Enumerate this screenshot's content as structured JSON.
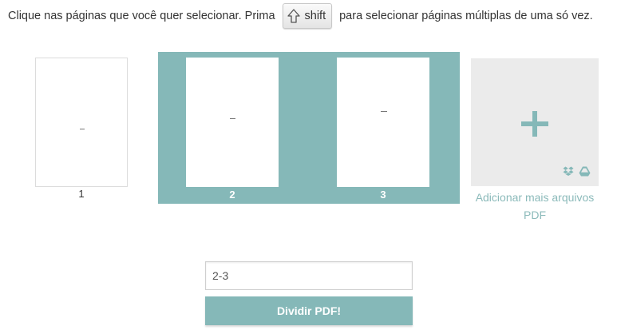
{
  "instruction": {
    "before": "Clique nas páginas que você quer selecionar. Prima",
    "key_label": "shift",
    "after": "para selecionar páginas múltiplas de uma só vez."
  },
  "pages": [
    {
      "number": "1",
      "selected": false
    },
    {
      "number": "2",
      "selected": true
    },
    {
      "number": "3",
      "selected": true
    }
  ],
  "add_files": {
    "label_line1": "Adicionar mais arquivos",
    "label_line2": "PDF",
    "icons": [
      "plus-icon",
      "dropbox-icon",
      "google-drive-icon"
    ]
  },
  "range_input": {
    "value": "2-3"
  },
  "split_button": {
    "label": "Dividir PDF!"
  },
  "colors": {
    "accent": "#85b8b8",
    "accent_text": "#8bbaba",
    "add_box_bg": "#ebebeb"
  }
}
